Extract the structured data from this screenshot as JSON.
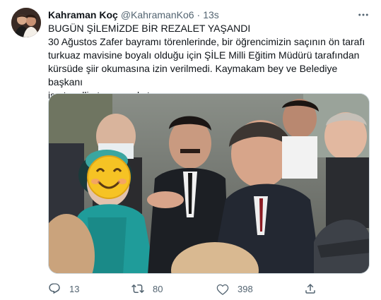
{
  "tweet": {
    "author_name": "Kahraman Koç",
    "handle": "@KahramanKo6",
    "separator": "·",
    "time": "13s",
    "text_lines": [
      "BUGÜN ŞİLEMİZDE BİR REZALET YAŞANDI",
      "30 Ağustos Zafer bayramı törenlerinde, bir öğrencimizin saçının ön tarafı",
      "turkuaz mavisine boyalı olduğu için ŞİLE Milli Eğitim Müdürü tarafından",
      "kürsüde şiir okumasına izin verilmedi. Kaymakam bey ve Belediye başkanı",
      "ise teselli etmeye çalıştı"
    ]
  },
  "icons": {
    "more": "more-icon",
    "reply": "reply-icon",
    "retweet": "retweet-icon",
    "like": "like-icon",
    "share": "share-icon",
    "emoji": "smiling-face-emoji"
  },
  "actions": {
    "reply_count": "13",
    "retweet_count": "80",
    "like_count": "398"
  },
  "colors": {
    "text": "#0f1419",
    "secondary": "#536471",
    "border": "#cfd9de",
    "accent": "#1d9bf0"
  }
}
